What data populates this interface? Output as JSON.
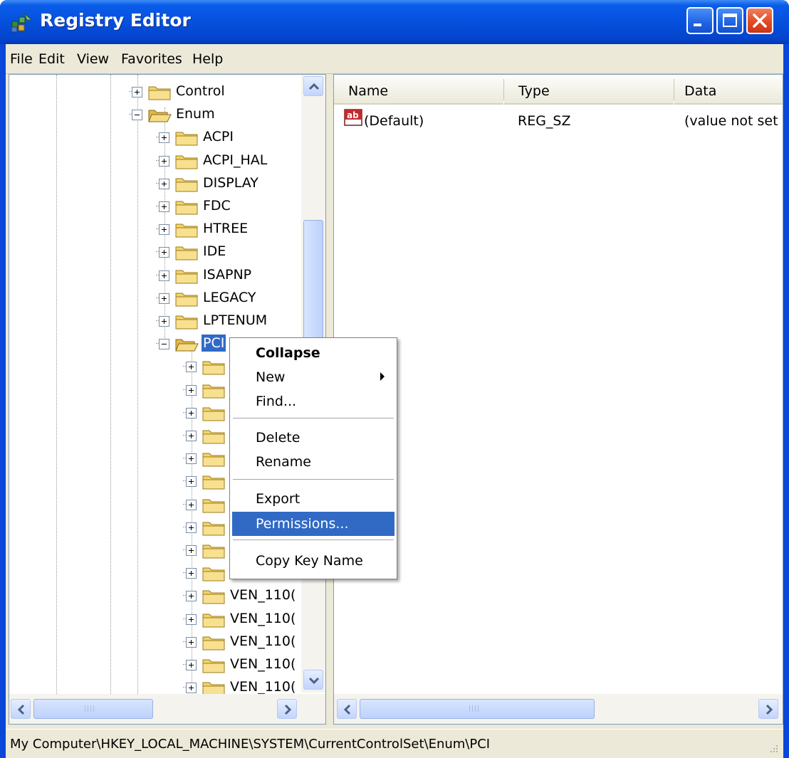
{
  "window": {
    "title": "Registry Editor",
    "accent": "#0a46d8",
    "controls": [
      {
        "name": "minimize",
        "icon": "minimize-icon"
      },
      {
        "name": "maximize",
        "icon": "maximize-icon"
      },
      {
        "name": "close",
        "icon": "close-icon"
      }
    ]
  },
  "menubar": {
    "items": [
      "File",
      "Edit",
      "View",
      "Favorites",
      "Help"
    ]
  },
  "tree": {
    "selected_path": "Enum > PCI",
    "nodes": [
      {
        "label": "Control",
        "expanded": false
      },
      {
        "label": "Enum",
        "expanded": true
      },
      {
        "label": "ACPI",
        "expanded": false
      },
      {
        "label": "ACPI_HAL",
        "expanded": false
      },
      {
        "label": "DISPLAY",
        "expanded": false
      },
      {
        "label": "FDC",
        "expanded": false
      },
      {
        "label": "HTREE",
        "expanded": false
      },
      {
        "label": "IDE",
        "expanded": false
      },
      {
        "label": "ISAPNP",
        "expanded": false
      },
      {
        "label": "LEGACY",
        "expanded": false
      },
      {
        "label": "LPTENUM",
        "expanded": false
      },
      {
        "label": "PCI",
        "expanded": true,
        "selected": true
      },
      {
        "label": "",
        "expanded": false
      },
      {
        "label": "",
        "expanded": false
      },
      {
        "label": "",
        "expanded": false
      },
      {
        "label": "",
        "expanded": false
      },
      {
        "label": "",
        "expanded": false
      },
      {
        "label": "",
        "expanded": false
      },
      {
        "label": "",
        "expanded": false
      },
      {
        "label": "",
        "expanded": false
      },
      {
        "label": "",
        "expanded": false
      },
      {
        "label": "",
        "expanded": false
      },
      {
        "label": "VEN_110(",
        "expanded": false
      },
      {
        "label": "VEN_110(",
        "expanded": false
      },
      {
        "label": "VEN_110(",
        "expanded": false
      },
      {
        "label": "VEN_110(",
        "expanded": false
      },
      {
        "label": "VEN_110(",
        "expanded": false
      }
    ],
    "scroll_position": 0.45
  },
  "values": {
    "columns": [
      "Name",
      "Type",
      "Data"
    ],
    "rows": [
      {
        "icon": "string-value-icon",
        "name": "(Default)",
        "type": "REG_SZ",
        "data": "(value not set"
      }
    ]
  },
  "context_menu": {
    "items": [
      {
        "label": "Collapse",
        "bold": true
      },
      {
        "label": "New",
        "submenu": true
      },
      {
        "label": "Find..."
      },
      {
        "separator": true
      },
      {
        "label": "Delete"
      },
      {
        "label": "Rename"
      },
      {
        "separator": true
      },
      {
        "label": "Export"
      },
      {
        "label": "Permissions...",
        "highlighted": true
      },
      {
        "separator": true
      },
      {
        "label": "Copy Key Name"
      }
    ],
    "labels": {
      "collapse": "Collapse",
      "new": "New",
      "find": "Find...",
      "delete": "Delete",
      "rename": "Rename",
      "export": "Export",
      "permissions": "Permissions...",
      "copy_key_name": "Copy Key Name"
    }
  },
  "statusbar": {
    "path": "My Computer\\HKEY_LOCAL_MACHINE\\SYSTEM\\CurrentControlSet\\Enum\\PCI"
  },
  "colors": {
    "selection": "#316ac5",
    "menu_bg": "#ece9d8",
    "folder": "#f2d36b"
  }
}
